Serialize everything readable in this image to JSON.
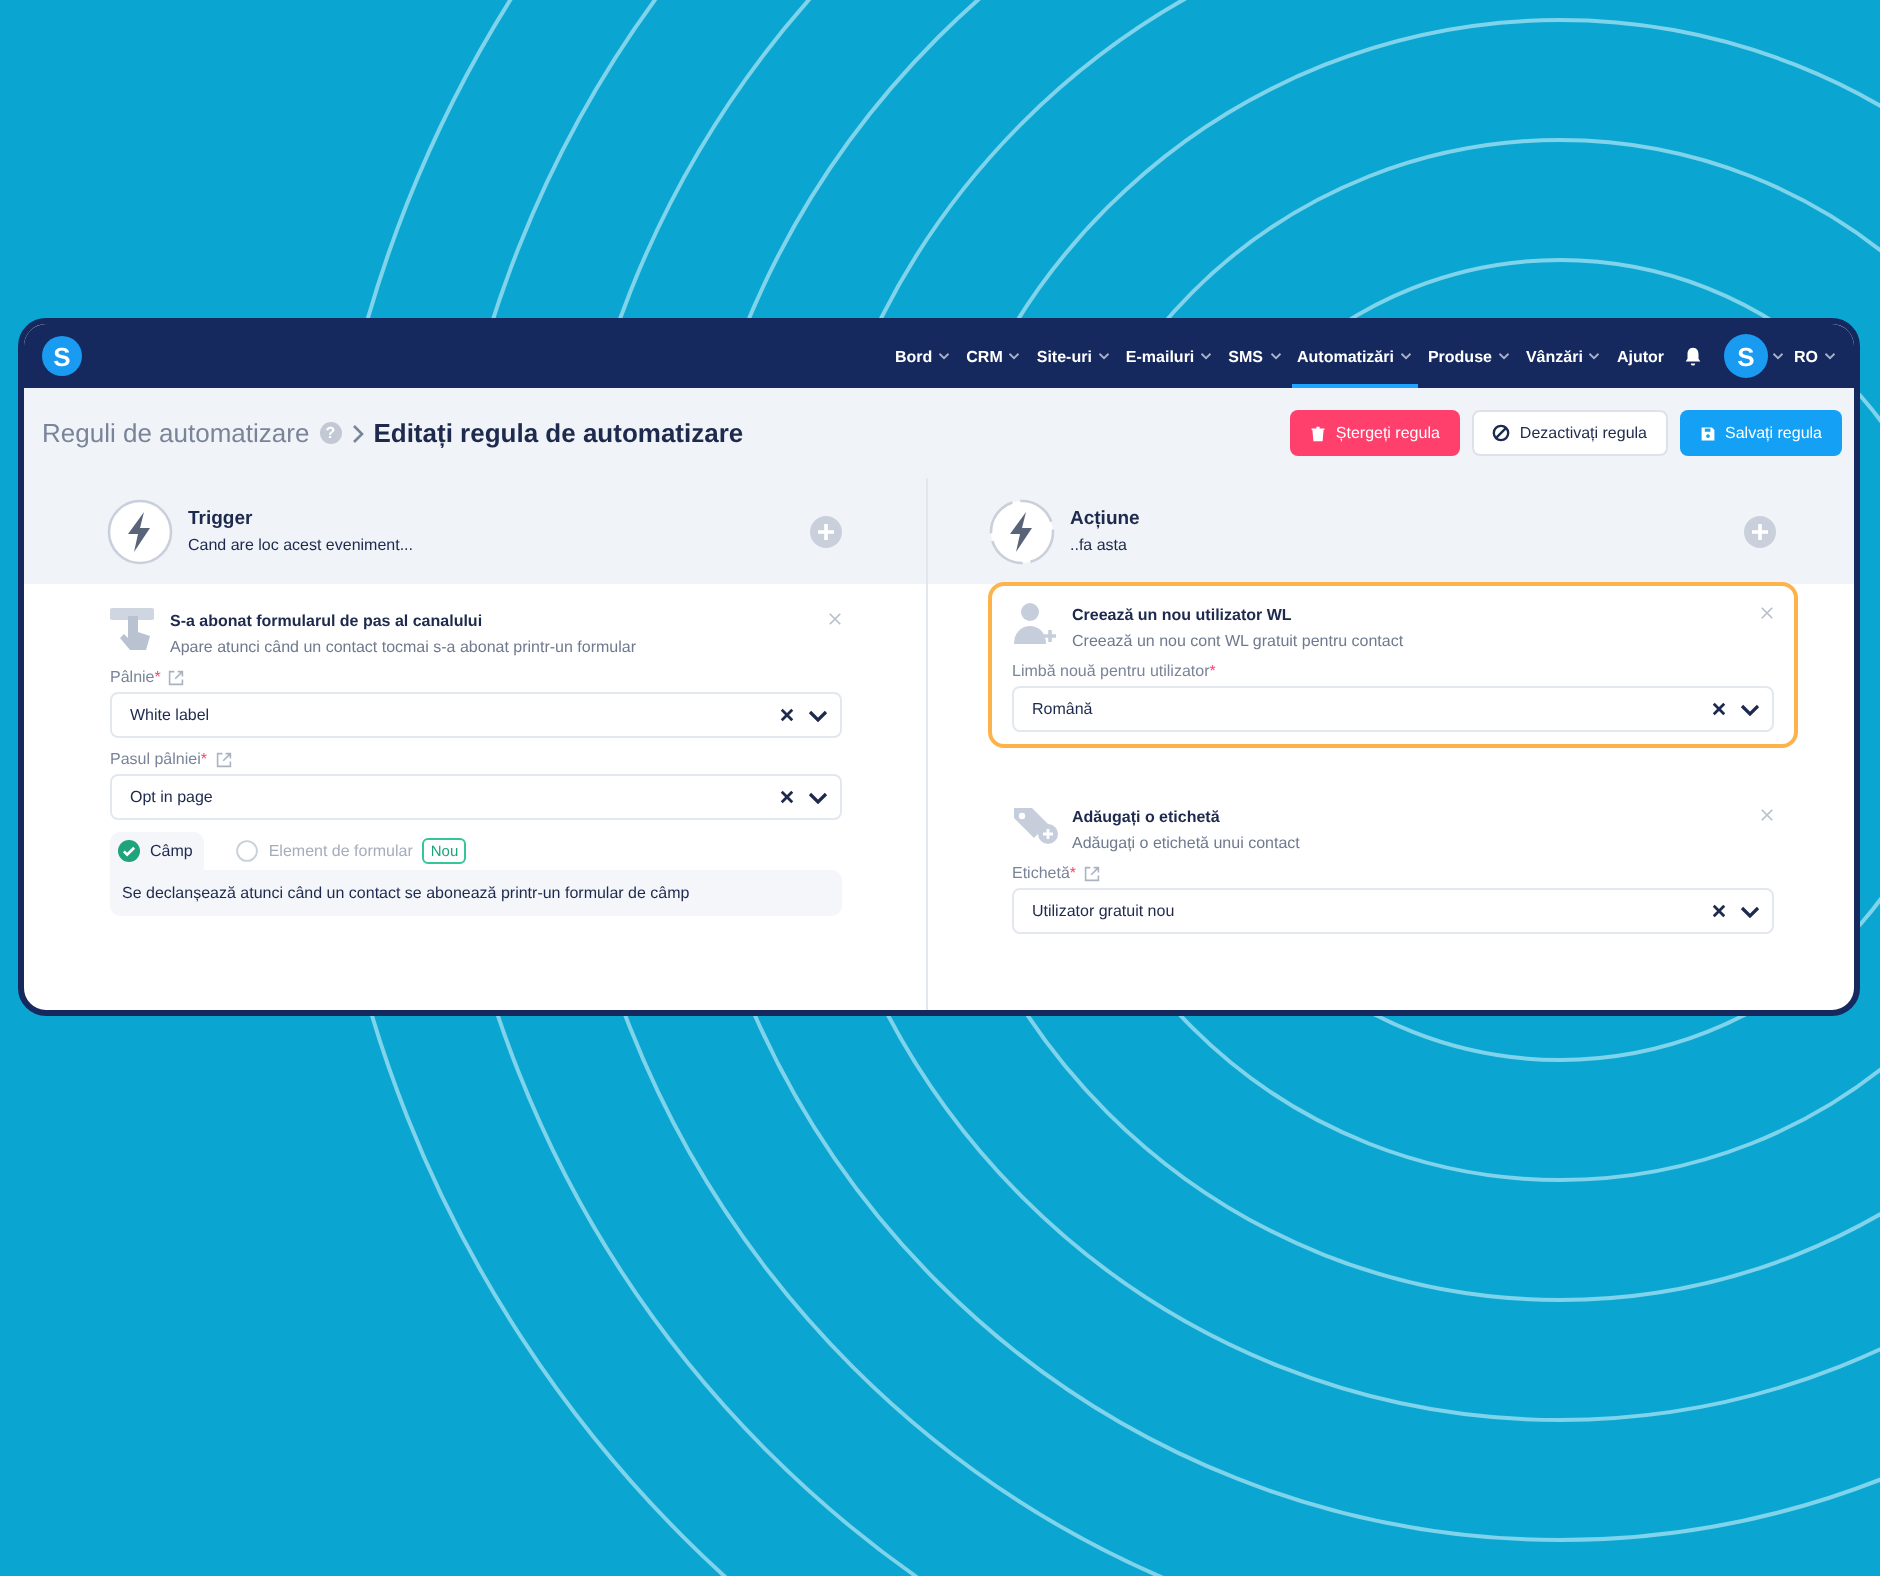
{
  "navbar": {
    "logo": "S",
    "items": [
      {
        "label": "Bord",
        "dropdown": true,
        "selected": false
      },
      {
        "label": "CRM",
        "dropdown": true,
        "selected": false
      },
      {
        "label": "Site-uri",
        "dropdown": true,
        "selected": false
      },
      {
        "label": "E-mailuri",
        "dropdown": true,
        "selected": false
      },
      {
        "label": "SMS",
        "dropdown": true,
        "selected": false
      },
      {
        "label": "Automatizări",
        "dropdown": true,
        "selected": true
      },
      {
        "label": "Produse",
        "dropdown": true,
        "selected": false
      },
      {
        "label": "Vânzări",
        "dropdown": true,
        "selected": false
      },
      {
        "label": "Ajutor",
        "dropdown": false,
        "selected": false
      }
    ],
    "avatar": "S",
    "language": "RO"
  },
  "breadcrumb": {
    "parent": "Reguli de automatizare",
    "help": "?",
    "current": "Editați regula de automatizare"
  },
  "buttons": [
    {
      "kind": "delete",
      "label": "Ștergeți regula"
    },
    {
      "kind": "deactivate",
      "label": "Dezactivați regula"
    },
    {
      "kind": "save",
      "label": "Salvați regula"
    }
  ],
  "trigger": {
    "title": "Trigger",
    "subtitle": "Cand are loc acest eveniment...",
    "cards": [
      {
        "kind": "form",
        "highlighted": false,
        "title": "S-a abonat formularul de pas al canalului",
        "description": "Apare atunci când un contact tocmai s-a abonat printr-un formular",
        "fields": [
          {
            "label": "Pâlnie",
            "required": "*",
            "link": true,
            "value": "White label"
          },
          {
            "label": "Pasul pâlniei",
            "required": "*",
            "link": true,
            "value": "Opt in page"
          }
        ],
        "options": [
          {
            "label": "Câmp",
            "selected": true
          },
          {
            "label": "Element de formular",
            "selected": false,
            "badge": "Nou"
          }
        ],
        "option_description": "Se declanșează atunci când un contact se abonează printr-un formular de câmp"
      }
    ]
  },
  "action": {
    "title": "Acțiune",
    "subtitle": "..fa asta",
    "cards": [
      {
        "kind": "user",
        "highlighted": true,
        "title": "Creează un nou utilizator WL",
        "description": "Creează un nou cont WL gratuit pentru contact",
        "fields": [
          {
            "label": "Limbă nouă pentru utilizator",
            "required": "*",
            "link": false,
            "value": "Română"
          }
        ]
      },
      {
        "kind": "tag",
        "highlighted": false,
        "title": "Adăugați o etichetă",
        "description": "Adăugați o etichetă unui contact",
        "fields": [
          {
            "label": "Etichetă",
            "required": "*",
            "link": true,
            "value": "Utilizator gratuit nou"
          }
        ]
      }
    ]
  }
}
